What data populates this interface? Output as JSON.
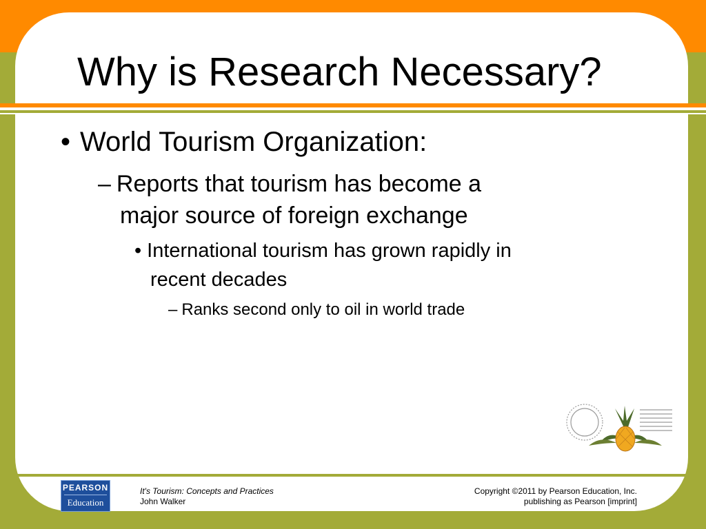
{
  "slide": {
    "title": "Why is Research Necessary?",
    "bullets": [
      {
        "marker": "•",
        "text": "World Tourism Organization:"
      },
      {
        "marker": "–",
        "text": "Reports that tourism has become a",
        "continuation": "major source of foreign exchange"
      },
      {
        "marker": "•",
        "text": "International tourism has grown rapidly in",
        "continuation": "recent decades"
      },
      {
        "marker": "–",
        "text": "Ranks second only to oil in world trade"
      }
    ]
  },
  "footer": {
    "logo_top": "PEARSON",
    "logo_bottom": "Education",
    "book_title": "It's Tourism: Concepts and Practices",
    "author": "John Walker",
    "copyright": "Copyright ©2011 by Pearson Education, Inc.",
    "imprint": "publishing as Pearson [imprint]"
  },
  "colors": {
    "accent_orange": "#ff8a00",
    "accent_olive": "#a3ab38",
    "logo_blue": "#1e4f9c"
  }
}
